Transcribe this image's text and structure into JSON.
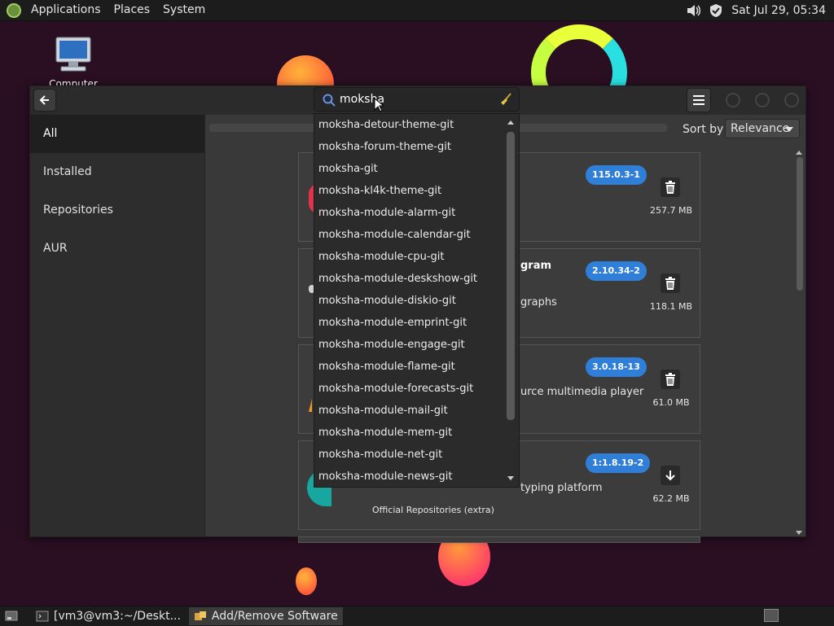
{
  "top_panel": {
    "menus": [
      "Applications",
      "Places",
      "System"
    ],
    "clock": "Sat Jul 29, 05:34"
  },
  "desktop": {
    "computer_label": "Computer"
  },
  "window": {
    "search_value": "moksha",
    "completions": [
      "moksha-detour-theme-git",
      "moksha-forum-theme-git",
      "moksha-git",
      "moksha-kl4k-theme-git",
      "moksha-module-alarm-git",
      "moksha-module-calendar-git",
      "moksha-module-cpu-git",
      "moksha-module-deskshow-git",
      "moksha-module-diskio-git",
      "moksha-module-emprint-git",
      "moksha-module-engage-git",
      "moksha-module-flame-git",
      "moksha-module-forecasts-git",
      "moksha-module-mail-git",
      "moksha-module-mem-git",
      "moksha-module-net-git",
      "moksha-module-news-git"
    ],
    "sidebar": [
      {
        "label": "All",
        "active": true
      },
      {
        "label": "Installed",
        "active": false
      },
      {
        "label": "Repositories",
        "active": false
      },
      {
        "label": "AUR",
        "active": false
      }
    ],
    "sort_label": "Sort by",
    "sort_value": "Relevance",
    "packages": [
      {
        "name": "",
        "desc": "",
        "repo": "",
        "version": "115.0.3-1",
        "size": "257.7 MB",
        "action": "remove"
      },
      {
        "name": "gram",
        "desc": "graphs",
        "repo": "",
        "version": "2.10.34-2",
        "size": "118.1 MB",
        "action": "remove"
      },
      {
        "name": "",
        "desc": "urce multimedia player",
        "repo": "",
        "version": "3.0.18-13",
        "size": "61.0 MB",
        "action": "remove"
      },
      {
        "name": "",
        "desc": "typing platform",
        "repo": "Official Repositories (extra)",
        "version": "1:1.8.19-2",
        "size": "62.2 MB",
        "action": "install"
      }
    ]
  },
  "taskbar": {
    "tasks": [
      "[vm3@vm3:~/Deskt...",
      "Add/Remove Software"
    ]
  },
  "colors": {
    "accent": "#2f7ed8",
    "panel": "#1c1c1c",
    "window": "#353535"
  }
}
